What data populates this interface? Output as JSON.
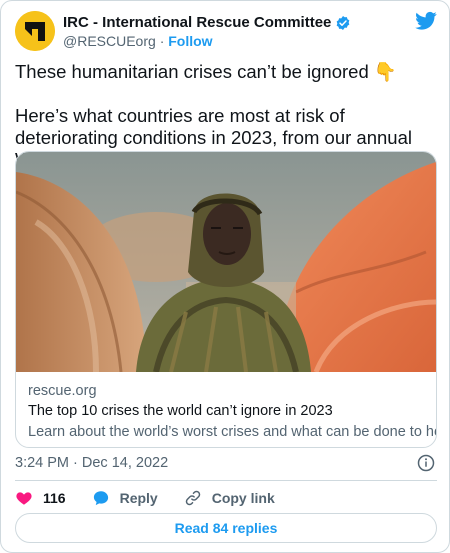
{
  "author": {
    "name": "IRC - International Rescue Committee",
    "handle": "@RESCUEorg",
    "separator": "·",
    "follow_label": "Follow",
    "avatar_icon": "irc-logo-icon",
    "verified_icon": "verified-badge-icon"
  },
  "tweet": {
    "line1": "These humanitarian crises can’t be ignored 👇",
    "line2": "Here’s what countries are most at risk of deteriorating conditions in 2023, from our annual Watchlist:"
  },
  "link_card": {
    "domain": "rescue.org",
    "title": "The top 10 crises the world can’t ignore in 2023",
    "description": "Learn about the world’s worst crises and what can be done to help."
  },
  "meta": {
    "timestamp": "3:24 PM · Dec 14, 2022"
  },
  "actions": {
    "like_count": "116",
    "reply_label": "Reply",
    "copy_link_label": "Copy link"
  },
  "read_replies_label": "Read 84 replies",
  "colors": {
    "accent": "#1d9bf0",
    "like": "#f91880",
    "text_secondary": "#536471",
    "border": "#cfd9de",
    "brand_yellow": "#f6c21a"
  }
}
